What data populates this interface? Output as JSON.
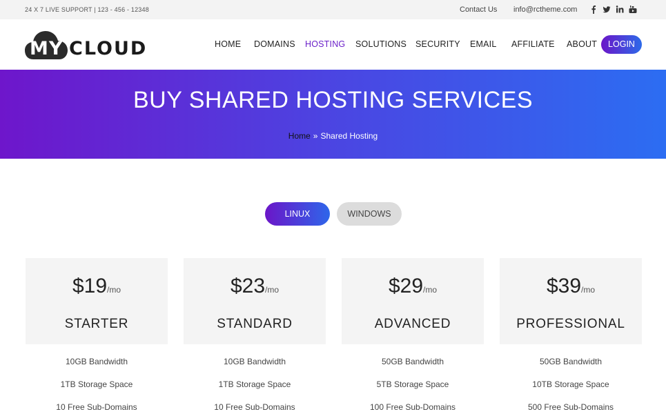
{
  "topbar": {
    "support": "24 X 7 LIVE SUPPORT  |  123 - 456 - 12348",
    "contact_link": "Contact Us",
    "email": "info@rctheme.com",
    "socials": [
      "facebook-icon",
      "twitter-icon",
      "linkedin-icon",
      "youtube-icon"
    ]
  },
  "logo": {
    "part1": "MY",
    "part2": "CLOUD"
  },
  "nav": {
    "items": [
      "HOME",
      "DOMAINS",
      "HOSTING",
      "SOLUTIONS",
      "SECURITY",
      "EMAIL",
      "AFFILIATE",
      "ABOUT"
    ],
    "active": "HOSTING",
    "login": "LOGIN"
  },
  "hero": {
    "title": "BUY SHARED HOSTING SERVICES",
    "breadcrumb_home": "Home",
    "breadcrumb_separator": "»",
    "breadcrumb_current": "Shared Hosting"
  },
  "tabs": {
    "linux": "LINUX",
    "windows": "WINDOWS",
    "active": "LINUX"
  },
  "plans": [
    {
      "price": "$19",
      "period": "/mo",
      "name": "STARTER",
      "features": [
        "10GB Bandwidth",
        "1TB Storage Space",
        "10 Free Sub-Domains"
      ]
    },
    {
      "price": "$23",
      "period": "/mo",
      "name": "STANDARD",
      "features": [
        "10GB Bandwidth",
        "1TB Storage Space",
        "10 Free Sub-Domains"
      ]
    },
    {
      "price": "$29",
      "period": "/mo",
      "name": "ADVANCED",
      "features": [
        "50GB Bandwidth",
        "5TB Storage Space",
        "100 Free Sub-Domains"
      ]
    },
    {
      "price": "$39",
      "period": "/mo",
      "name": "PROFESSIONAL",
      "features": [
        "50GB Bandwidth",
        "10TB Storage Space",
        "500 Free Sub-Domains"
      ]
    }
  ],
  "colors": {
    "accent_purple": "#6b16c8",
    "accent_blue": "#2d6ae9",
    "topbar_bg": "#f3f3f3",
    "card_head_bg": "#f4f4f4"
  }
}
